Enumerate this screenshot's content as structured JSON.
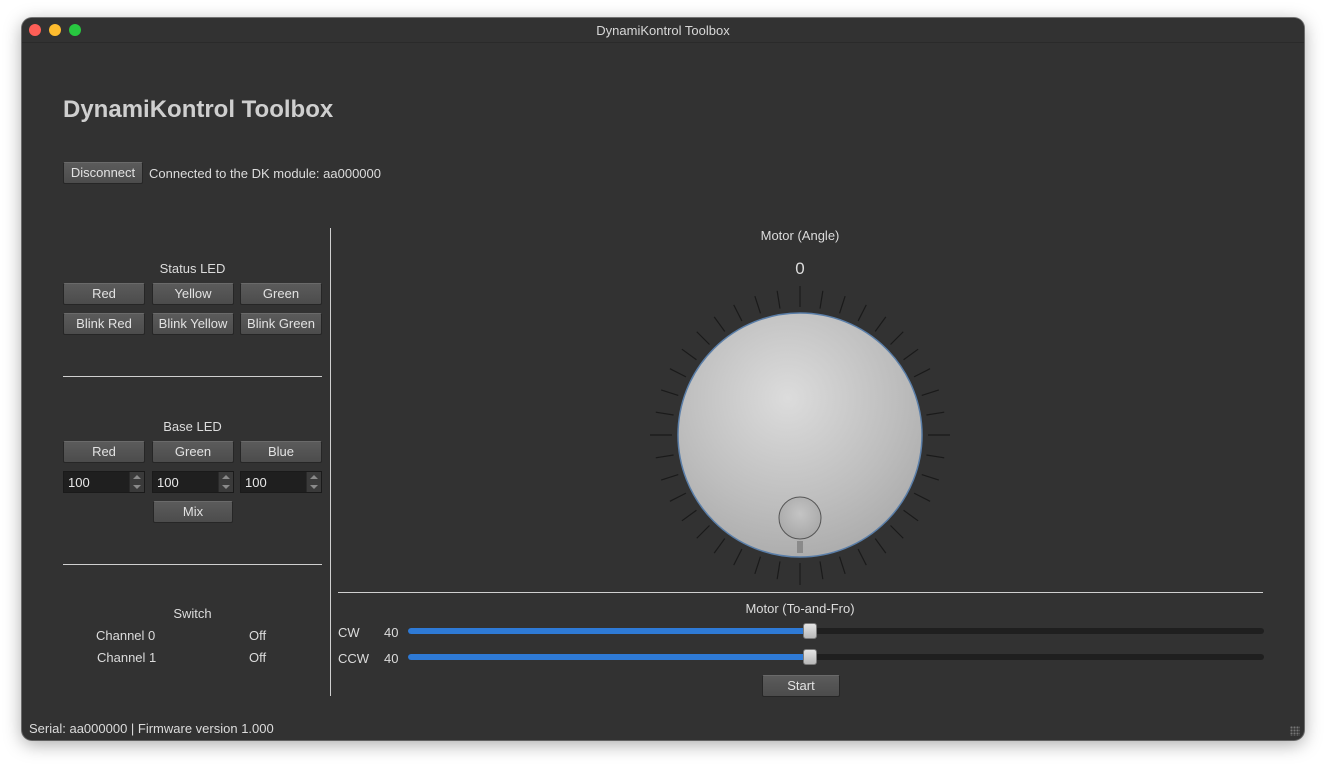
{
  "window": {
    "title": "DynamiKontrol Toolbox"
  },
  "app": {
    "title": "DynamiKontrol Toolbox"
  },
  "connection": {
    "disconnect_label": "Disconnect",
    "status_text": "Connected to the DK module: aa000000"
  },
  "status_led": {
    "title": "Status LED",
    "buttons": [
      "Red",
      "Yellow",
      "Green",
      "Blink Red",
      "Blink Yellow",
      "Blink Green"
    ]
  },
  "base_led": {
    "title": "Base LED",
    "buttons": [
      "Red",
      "Green",
      "Blue"
    ],
    "values": [
      "100",
      "100",
      "100"
    ],
    "mix_label": "Mix"
  },
  "switch": {
    "title": "Switch",
    "channels": [
      {
        "name": "Channel 0",
        "state": "Off"
      },
      {
        "name": "Channel 1",
        "state": "Off"
      }
    ]
  },
  "motor_angle": {
    "title": "Motor (Angle)",
    "value": "0",
    "dial_angle_degrees": 0
  },
  "motor_tofro": {
    "title": "Motor (To-and-Fro)",
    "cw": {
      "label": "CW",
      "value": "40",
      "level": 0.47
    },
    "ccw": {
      "label": "CCW",
      "value": "40",
      "level": 0.47
    },
    "start_label": "Start"
  },
  "statusbar": {
    "text": "Serial: aa000000 | Firmware version 1.000"
  },
  "colors": {
    "accent": "#2e7ad6",
    "background": "#323232",
    "dial_ring": "#5a7ea8"
  },
  "icons": [
    "close-icon",
    "minimize-icon",
    "zoom-icon",
    "resize-grip-icon"
  ]
}
